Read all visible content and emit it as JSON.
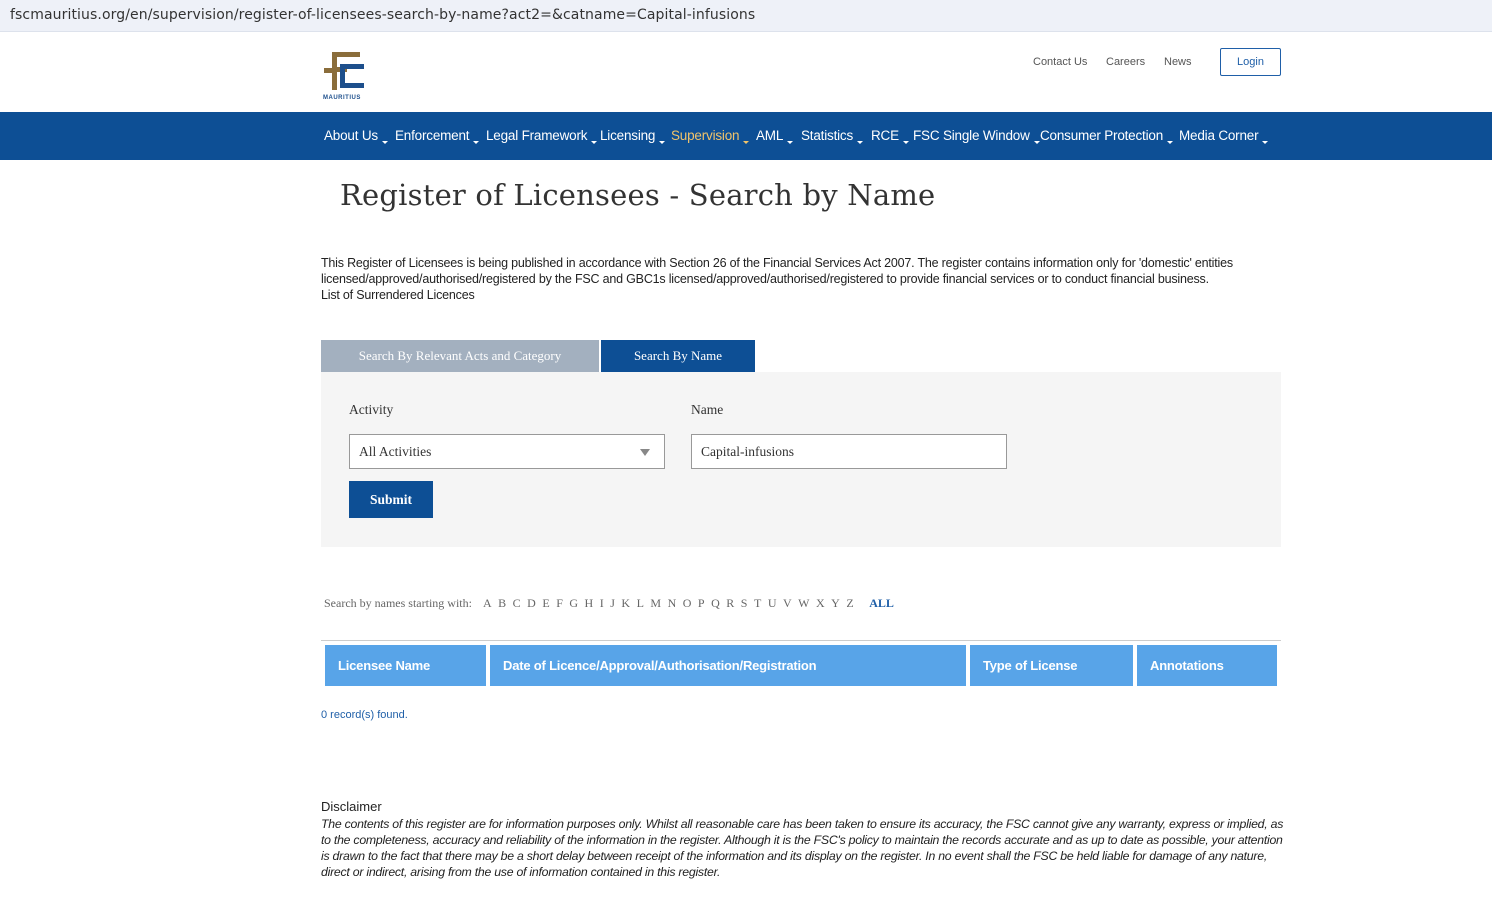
{
  "browser": {
    "url": "fscmauritius.org/en/supervision/register-of-licensees-search-by-name?act2=&catname=Capital-infusions"
  },
  "header": {
    "logo_text": "MAURITIUS",
    "top_links": [
      "Contact Us",
      "Careers",
      "News"
    ],
    "login_label": "Login"
  },
  "nav": {
    "items": [
      {
        "label": "About Us"
      },
      {
        "label": "Enforcement"
      },
      {
        "label": "Legal Framework"
      },
      {
        "label": "Licensing"
      },
      {
        "label": "Supervision"
      },
      {
        "label": "AML"
      },
      {
        "label": "Statistics"
      },
      {
        "label": "RCE"
      },
      {
        "label": "FSC Single Window"
      },
      {
        "label": "Consumer Protection"
      },
      {
        "label": "Media Corner"
      }
    ],
    "active": "Supervision"
  },
  "colors": {
    "brand_blue": "#0d4f95",
    "active_nav": "#f0c36a",
    "table_header": "#58a4e8",
    "tab_inactive": "#a3b0bf"
  },
  "page": {
    "title": "Register of Licensees - Search by Name",
    "intro_line1": "This Register of Licensees is being published in accordance with Section 26 of the Financial Services Act 2007. The register contains information only for 'domestic' entities licensed/approved/authorised/registered by the FSC and GBC1s licensed/approved/authorised/registered to provide financial services or to conduct financial business.",
    "intro_line2": "List of Surrendered Licences"
  },
  "tabs": {
    "acts": "Search By Relevant Acts and Category",
    "name": "Search By Name"
  },
  "form": {
    "activity_label": "Activity",
    "activity_value": "All Activities",
    "name_label": "Name",
    "name_value": "Capital-infusions",
    "submit_label": "Submit"
  },
  "alphabet": {
    "label": "Search by names starting with:",
    "letters": [
      "A",
      "B",
      "C",
      "D",
      "E",
      "F",
      "G",
      "H",
      "I",
      "J",
      "K",
      "L",
      "M",
      "N",
      "O",
      "P",
      "Q",
      "R",
      "S",
      "T",
      "U",
      "V",
      "W",
      "X",
      "Y",
      "Z"
    ],
    "all_label": "ALL"
  },
  "table": {
    "headers": [
      "Licensee Name",
      "Date of Licence/Approval/Authorisation/Registration",
      "Type of License",
      "Annotations"
    ],
    "records_text": "0 record(s) found."
  },
  "disclaimer": {
    "title": "Disclaimer",
    "text": "The contents of this register are for information purposes only. Whilst all reasonable care has been taken to ensure its accuracy, the FSC cannot give any warranty, express or implied, as to the completeness, accuracy and reliability of the information in the register. Although it is the FSC's policy to maintain the records accurate and as up to date as possible, your attention is drawn to the fact that there may be a short delay between receipt of the information and its display on the register. In no event shall the FSC be held liable for damage of any nature, direct or indirect, arising from the use of information contained in this register."
  }
}
